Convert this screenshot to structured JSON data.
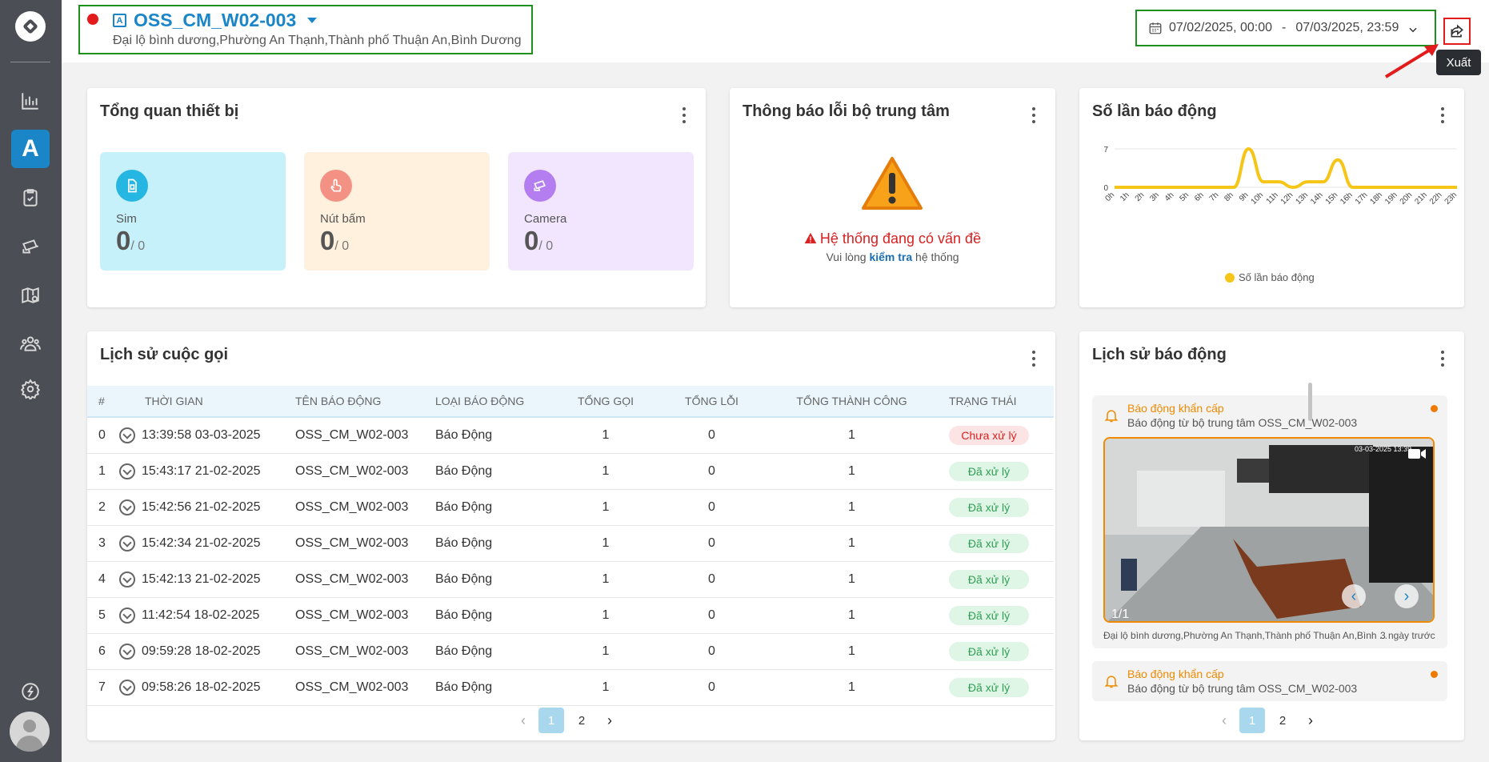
{
  "header": {
    "site_name": "OSS_CM_W02-003",
    "site_address": "Đại lộ bình dương,Phường An Thạnh,Thành phố Thuận An,Bình Dương",
    "site_icon": "A",
    "date_from": "07/02/2025, 00:00",
    "date_sep": "-",
    "date_to": "07/03/2025, 23:59",
    "export_tooltip": "Xuất"
  },
  "sidebar": {
    "active_letter": "A",
    "items": [
      "chart-icon",
      "site-icon",
      "clipboard-check-icon",
      "cctv-icon",
      "map-pin-icon",
      "users-icon",
      "gear-icon",
      "help-icon"
    ]
  },
  "overview": {
    "title": "Tổng quan thiết bị",
    "stats": [
      {
        "label": "Sim",
        "value": "0",
        "total": "/ 0",
        "color": "#c6f1fb",
        "icon_color": "#25b6e1"
      },
      {
        "label": "Nút bấm",
        "value": "0",
        "total": "/ 0",
        "color": "#fff1dd",
        "icon_color": "#f39284"
      },
      {
        "label": "Camera",
        "value": "0",
        "total": "/ 0",
        "color": "#f1e6fd",
        "icon_color": "#b57ef0"
      }
    ]
  },
  "central_error": {
    "title": "Thông báo lỗi bộ trung tâm",
    "message": "Hệ thống đang có vấn đề",
    "sub_pre": "Vui lòng",
    "sub_link": "kiểm tra",
    "sub_post": "hệ thống"
  },
  "alarm_count": {
    "title": "Số lần báo động",
    "legend": "Số lần báo động"
  },
  "chart_data": {
    "type": "line",
    "title": "Số lần báo động",
    "categories": [
      "0h",
      "1h",
      "2h",
      "3h",
      "4h",
      "5h",
      "6h",
      "7h",
      "8h",
      "9h",
      "10h",
      "11h",
      "12h",
      "13h",
      "14h",
      "15h",
      "16h",
      "17h",
      "18h",
      "19h",
      "20h",
      "21h",
      "22h",
      "23h"
    ],
    "series": [
      {
        "name": "Số lần báo động",
        "values": [
          0,
          0,
          0,
          0,
          0,
          0,
          0,
          0,
          0,
          7,
          1,
          1,
          0,
          1,
          1,
          5,
          0,
          0,
          0,
          0,
          0,
          0,
          0,
          0
        ]
      }
    ],
    "yticks": [
      "7",
      "0"
    ],
    "ylim": [
      0,
      7
    ],
    "color": "#f5c518",
    "legend_position": "bottom"
  },
  "call_history": {
    "title": "Lịch sử cuộc gọi",
    "columns": [
      "#",
      "THỜI GIAN",
      "TÊN BÁO ĐỘNG",
      "LOẠI BÁO ĐỘNG",
      "TỔNG GỌI",
      "TỔNG LỖI",
      "TỔNG THÀNH CÔNG",
      "TRẠNG THÁI"
    ],
    "rows": [
      {
        "num": "0",
        "time": "13:39:58 03-03-2025",
        "name": "OSS_CM_W02-003",
        "type": "Báo Động",
        "calls": "1",
        "errors": "0",
        "success": "1",
        "status": "Chưa xử lý",
        "status_kind": "red"
      },
      {
        "num": "1",
        "time": "15:43:17 21-02-2025",
        "name": "OSS_CM_W02-003",
        "type": "Báo Động",
        "calls": "1",
        "errors": "0",
        "success": "1",
        "status": "Đã xử lý",
        "status_kind": "green"
      },
      {
        "num": "2",
        "time": "15:42:56 21-02-2025",
        "name": "OSS_CM_W02-003",
        "type": "Báo Động",
        "calls": "1",
        "errors": "0",
        "success": "1",
        "status": "Đã xử lý",
        "status_kind": "green"
      },
      {
        "num": "3",
        "time": "15:42:34 21-02-2025",
        "name": "OSS_CM_W02-003",
        "type": "Báo Động",
        "calls": "1",
        "errors": "0",
        "success": "1",
        "status": "Đã xử lý",
        "status_kind": "green"
      },
      {
        "num": "4",
        "time": "15:42:13 21-02-2025",
        "name": "OSS_CM_W02-003",
        "type": "Báo Động",
        "calls": "1",
        "errors": "0",
        "success": "1",
        "status": "Đã xử lý",
        "status_kind": "green"
      },
      {
        "num": "5",
        "time": "11:42:54 18-02-2025",
        "name": "OSS_CM_W02-003",
        "type": "Báo Động",
        "calls": "1",
        "errors": "0",
        "success": "1",
        "status": "Đã xử lý",
        "status_kind": "green"
      },
      {
        "num": "6",
        "time": "09:59:28 18-02-2025",
        "name": "OSS_CM_W02-003",
        "type": "Báo Động",
        "calls": "1",
        "errors": "0",
        "success": "1",
        "status": "Đã xử lý",
        "status_kind": "green"
      },
      {
        "num": "7",
        "time": "09:58:26 18-02-2025",
        "name": "OSS_CM_W02-003",
        "type": "Báo Động",
        "calls": "1",
        "errors": "0",
        "success": "1",
        "status": "Đã xử lý",
        "status_kind": "green"
      }
    ],
    "pages": [
      "1",
      "2"
    ],
    "current_page": "1"
  },
  "alarm_history": {
    "title": "Lịch sử báo động",
    "items": [
      {
        "title": "Báo động khẩn cấp",
        "desc": "Báo động từ bộ trung tâm OSS_CM_W02-003",
        "image_timestamp": "03-03-2025 13:39",
        "image_counter": "1/1",
        "address": "Đại lộ bình dương,Phường An Thạnh,Thành phố Thuận An,Bình ...",
        "ago": "3 ngày trước"
      },
      {
        "title": "Báo động khẩn cấp",
        "desc": "Báo động từ bộ trung tâm OSS_CM_W02-003"
      }
    ],
    "pages": [
      "1",
      "2"
    ],
    "current_page": "1"
  }
}
